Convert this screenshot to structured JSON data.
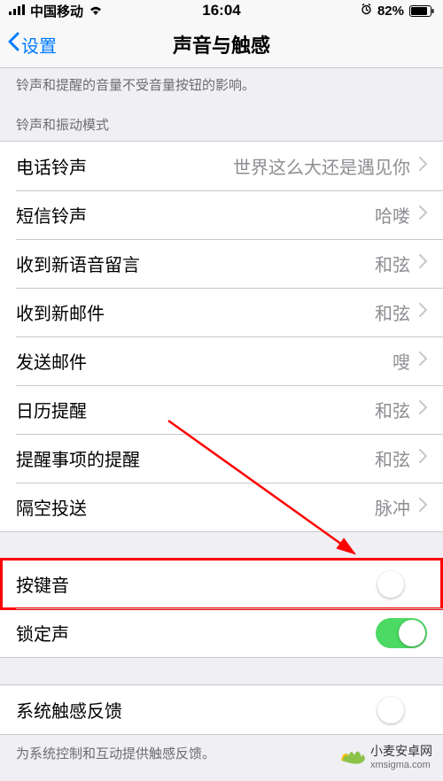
{
  "status": {
    "carrier": "中国移动",
    "time": "16:04",
    "battery": "82%"
  },
  "nav": {
    "back": "设置",
    "title": "声音与触感"
  },
  "intro_note": "铃声和提醒的音量不受音量按钮的影响。",
  "section_header": "铃声和振动模式",
  "rows": {
    "ringtone": {
      "label": "电话铃声",
      "value": "世界这么大还是遇见你"
    },
    "text_tone": {
      "label": "短信铃声",
      "value": "哈喽"
    },
    "voicemail": {
      "label": "收到新语音留言",
      "value": "和弦"
    },
    "new_mail": {
      "label": "收到新邮件",
      "value": "和弦"
    },
    "sent_mail": {
      "label": "发送邮件",
      "value": "嗖"
    },
    "calendar": {
      "label": "日历提醒",
      "value": "和弦"
    },
    "reminders": {
      "label": "提醒事项的提醒",
      "value": "和弦"
    },
    "airdrop": {
      "label": "隔空投送",
      "value": "脉冲"
    }
  },
  "toggles": {
    "keyboard_clicks": {
      "label": "按键音",
      "on": false
    },
    "lock_sound": {
      "label": "锁定声",
      "on": true
    }
  },
  "haptics": {
    "label": "系统触感反馈",
    "on": false,
    "footer": "为系统控制和互动提供触感反馈。"
  },
  "watermark": {
    "name": "小麦安卓网",
    "url": "xmsigma.com"
  }
}
